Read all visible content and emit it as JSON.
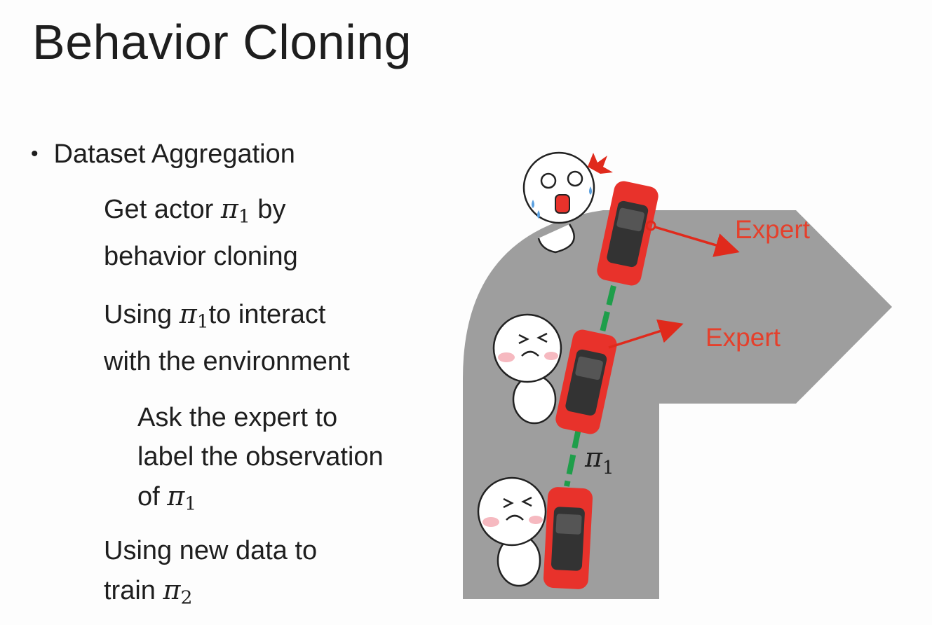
{
  "slide": {
    "title": "Behavior Cloning",
    "bullet": "Dataset Aggregation",
    "steps": [
      {
        "pre": "Get actor ",
        "sym": "π",
        "sub": "1",
        "post": " by",
        "line2": "behavior cloning"
      },
      {
        "pre": "Using ",
        "sym": "π",
        "sub": "1",
        "post": "to interact",
        "line2": "with the environment"
      },
      {
        "line1": "Ask the expert to",
        "line2": "label the observation",
        "pre": "of ",
        "sym": "π",
        "sub": "1"
      },
      {
        "line1": "Using new data to",
        "pre": "train ",
        "sym": "π",
        "sub": "2"
      }
    ]
  },
  "diagram": {
    "expert_label_1": "Expert",
    "expert_label_2": "Expert",
    "policy_sym": "π",
    "policy_sub": "1",
    "colors": {
      "road": "#9e9e9e",
      "car": "#e8322b",
      "trajectory": "#1e9e4a",
      "expert_arrow": "#e02a1c",
      "expert_text": "#e5402c"
    }
  }
}
